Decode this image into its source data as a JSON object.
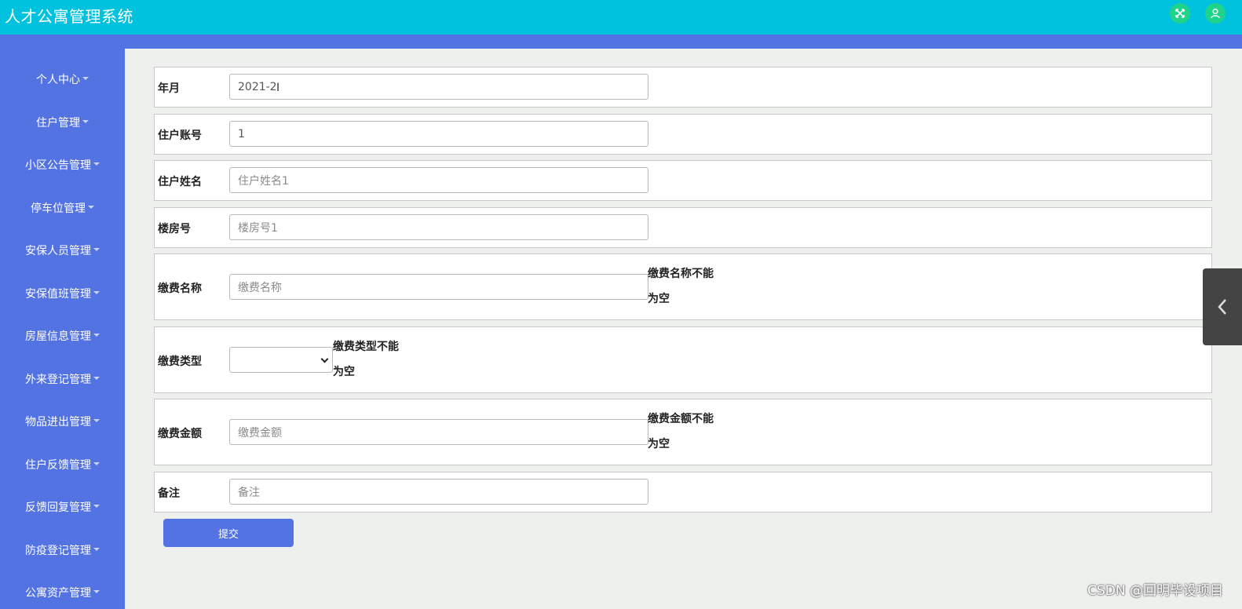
{
  "app": {
    "title": "人才公寓管理系统"
  },
  "colors": {
    "topbar": "#00c1de",
    "sidebar": "#5373e2",
    "icon_bg": "#1ed48a",
    "submit": "#5373e2"
  },
  "topbar_icons": [
    "fullscreen-icon",
    "user-icon"
  ],
  "sidebar": {
    "items": [
      {
        "label": "个人中心"
      },
      {
        "label": "住户管理"
      },
      {
        "label": "小区公告管理"
      },
      {
        "label": "停车位管理"
      },
      {
        "label": "安保人员管理"
      },
      {
        "label": "安保值班管理"
      },
      {
        "label": "房屋信息管理"
      },
      {
        "label": "外来登记管理"
      },
      {
        "label": "物品进出管理"
      },
      {
        "label": "住户反馈管理"
      },
      {
        "label": "反馈回复管理"
      },
      {
        "label": "防疫登记管理"
      },
      {
        "label": "公寓资产管理"
      }
    ]
  },
  "form": {
    "yearmonth": {
      "label": "年月",
      "value": "2021-2"
    },
    "account": {
      "label": "住户账号",
      "value": "1"
    },
    "name": {
      "label": "住户姓名",
      "placeholder": "住户姓名1"
    },
    "building": {
      "label": "楼房号",
      "placeholder": "楼房号1"
    },
    "fee_name": {
      "label": "缴费名称",
      "placeholder": "缴费名称",
      "error_line1": "缴费名称不能",
      "error_line2": "为空"
    },
    "fee_type": {
      "label": "缴费类型",
      "selected": "",
      "error_line1": "缴费类型不能",
      "error_line2": "为空"
    },
    "fee_amount": {
      "label": "缴费金额",
      "placeholder": "缴费金额",
      "error_line1": "缴费金额不能",
      "error_line2": "为空"
    },
    "remark": {
      "label": "备注",
      "placeholder": "备注"
    },
    "submit_label": "提交"
  },
  "watermark": "CSDN @回明毕设项目"
}
